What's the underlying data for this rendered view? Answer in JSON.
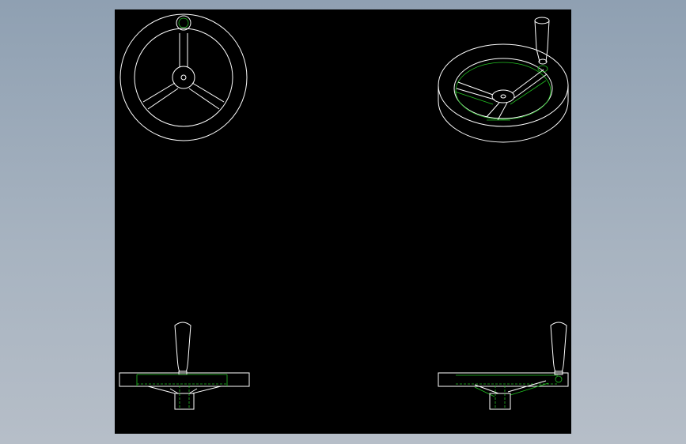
{
  "canvas": {
    "background": "#000000",
    "frame_color": "#a3b0bf"
  },
  "colors": {
    "outline": "#ffffff",
    "hidden_lines": "#22c022",
    "annotation": "#ff33ff"
  },
  "views": [
    {
      "name": "front-view"
    },
    {
      "name": "isometric-view"
    },
    {
      "name": "side-view-left"
    },
    {
      "name": "side-view-right"
    }
  ],
  "labels": {
    "left_text": "",
    "right_text": ""
  }
}
